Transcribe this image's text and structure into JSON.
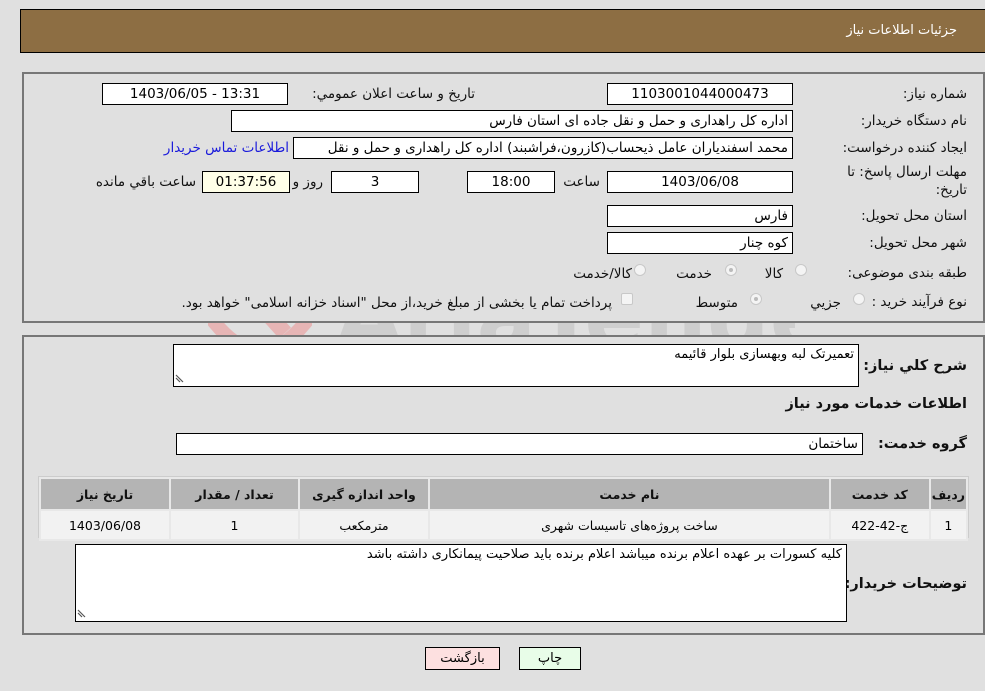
{
  "header": {
    "title": "جزئیات اطلاعات نیاز"
  },
  "info": {
    "need_number_label": "شماره نیاز:",
    "need_number": "1103001044000473",
    "announce_label": "تاریخ و ساعت اعلان عمومي:",
    "announce_value": "1403/06/05 - 13:31",
    "buyer_org_label": "نام دستگاه خریدار:",
    "buyer_org": "اداره کل راهداری و حمل و نقل جاده ای استان فارس",
    "creator_label": "ایجاد کننده درخواست:",
    "creator": "محمد اسفندیاران عامل ذیحساب(کازرون،فراشبند) اداره کل راهداری و حمل و نقل",
    "contact_link": "اطلاعات تماس خریدار",
    "deadline_label_1": "مهلت ارسال پاسخ: تا",
    "deadline_label_2": "تاریخ:",
    "deadline_date": "1403/06/08",
    "time_label": "ساعت",
    "deadline_time": "18:00",
    "days_value": "3",
    "days_label": "روز و",
    "remaining_value": "01:37:56",
    "remaining_label": "ساعت باقي مانده",
    "province_label": "استان محل تحویل:",
    "province": "فارس",
    "city_label": "شهر محل تحویل:",
    "city": "کوه چنار",
    "category_label": "طبقه بندی موضوعی:",
    "category_options": [
      "کالا",
      "خدمت",
      "کالا/خدمت"
    ],
    "category_selected": "خدمت",
    "process_label": "نوع فرآیند خرید :",
    "process_options": [
      "جزيي",
      "متوسط"
    ],
    "process_selected": "متوسط",
    "treasury_note": "پرداخت تمام یا بخشی از مبلغ خرید،از محل \"اسناد خزانه اسلامی\" خواهد بود."
  },
  "details": {
    "description_label": "شرح کلي نیاز:",
    "description": "تعمیرتک لبه وبهسازی بلوار قائیمه",
    "services_heading": "اطلاعات خدمات مورد نیاز",
    "service_group_label": "گروه خدمت:",
    "service_group": "ساختمان",
    "table": {
      "headers": [
        "ردیف",
        "کد خدمت",
        "نام خدمت",
        "واحد اندازه گیری",
        "تعداد / مقدار",
        "تاریخ نیاز"
      ],
      "rows": [
        [
          "1",
          "ج-42-422",
          "ساخت پروژه‌های تاسیسات شهری",
          "مترمکعب",
          "1",
          "1403/06/08"
        ]
      ]
    },
    "buyer_notes_label": "توضیحات خریدار:",
    "buyer_notes": "کلیه کسورات بر عهده اعلام برنده میباشد اعلام برنده باید صلاحیت پیمانکاری داشته باشد"
  },
  "buttons": {
    "print": "چاپ",
    "back": "بازگشت"
  },
  "colors": {
    "header_bg": "#8d6e43",
    "print_bg": "#e8fde8",
    "back_bg": "#fde0e0",
    "link": "#1a1adb"
  },
  "watermark": {
    "text": "AriaTender.neT"
  }
}
